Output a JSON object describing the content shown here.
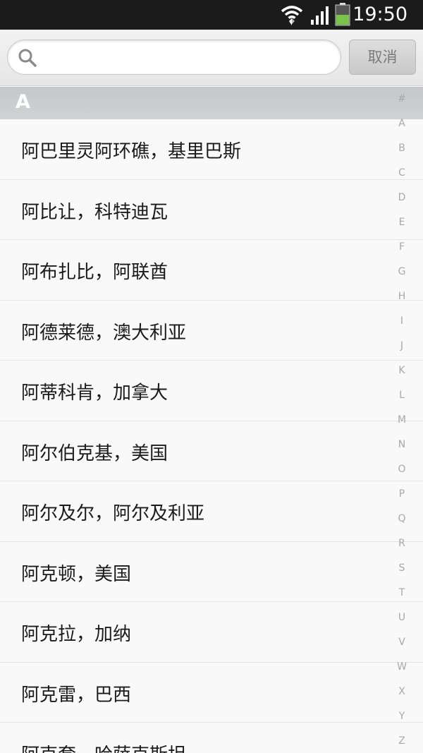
{
  "status_bar": {
    "time": "19:50",
    "icons": [
      "wifi-icon",
      "signal-icon",
      "battery-icon"
    ],
    "battery_color": "#7bc44c"
  },
  "search": {
    "placeholder": "",
    "value": "",
    "cancel_label": "取消"
  },
  "section": {
    "letter": "A"
  },
  "cities": [
    "阿巴里灵阿环礁，基里巴斯",
    "阿比让，科特迪瓦",
    "阿布扎比，阿联酋",
    "阿德莱德，澳大利亚",
    "阿蒂科肯，加拿大",
    "阿尔伯克基，美国",
    "阿尔及尔，阿尔及利亚",
    "阿克顿，美国",
    "阿克拉，加纳",
    "阿克雷，巴西",
    "阿克套，哈萨克斯坦"
  ],
  "index": [
    "#",
    "A",
    "B",
    "C",
    "D",
    "E",
    "F",
    "G",
    "H",
    "I",
    "J",
    "K",
    "L",
    "M",
    "N",
    "O",
    "P",
    "Q",
    "R",
    "S",
    "T",
    "U",
    "V",
    "W",
    "X",
    "Y",
    "Z"
  ],
  "colors": {
    "status_bg": "#1b1b1b",
    "section_bg": "#c9cbce",
    "index_text": "#a8a8a8"
  }
}
